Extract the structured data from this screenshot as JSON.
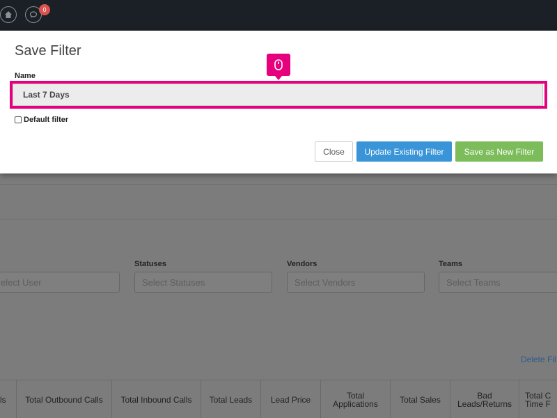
{
  "topbar": {
    "notification_count": "0",
    "icons": [
      "home-icon",
      "chat-icon"
    ]
  },
  "modal": {
    "title": "Save Filter",
    "name_label": "Name",
    "name_value": "Last 7 Days",
    "default_filter_label": "Default filter",
    "default_filter_checked": false,
    "buttons": {
      "close": "Close",
      "update": "Update Existing Filter",
      "save_new": "Save as New Filter"
    },
    "colors": {
      "update": "#3a94d8",
      "save_new": "#7cbc5a",
      "highlight": "#e6007e"
    }
  },
  "filters": {
    "user": {
      "label": "",
      "placeholder": "elect User"
    },
    "statuses": {
      "label": "Statuses",
      "placeholder": "Select Statuses"
    },
    "vendors": {
      "label": "Vendors",
      "placeholder": "Select Vendors"
    },
    "teams": {
      "label": "Teams",
      "placeholder": "Select Teams"
    }
  },
  "delete_link": "Delete Fil",
  "table": {
    "headers": [
      "ls",
      "Total Outbound Calls",
      "Total Inbound Calls",
      "Total Leads",
      "Lead Price",
      "Total Applications",
      "Total Sales",
      "Bad Leads/Returns",
      "Total C Time F"
    ]
  }
}
